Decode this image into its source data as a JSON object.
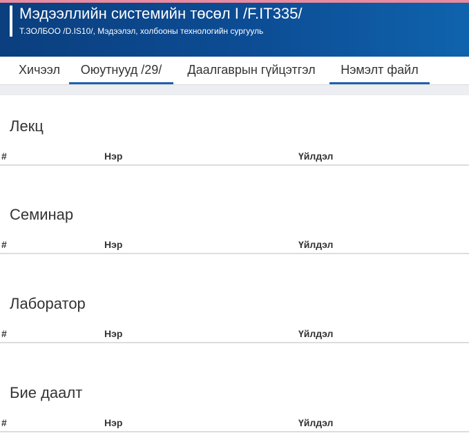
{
  "header": {
    "title": "Мэдээллийн системийн төсөл I /F.IT335/",
    "subtitle": "Т.ЗОЛБОО /D.IS10/, Мэдээлэл, холбооны технологийн сургууль"
  },
  "tabs": [
    {
      "label": "Хичээл",
      "active": false
    },
    {
      "label": "Оюутнууд /29/",
      "active": true
    },
    {
      "label": "Даалгаврын гүйцэтгэл",
      "active": false
    },
    {
      "label": "Нэмэлт файл",
      "active": true
    }
  ],
  "table_headers": {
    "num": "#",
    "name": "Нэр",
    "action": "Үйлдэл"
  },
  "sections": [
    {
      "title": "Лекц"
    },
    {
      "title": "Семинар"
    },
    {
      "title": "Лаборатор"
    },
    {
      "title": "Бие даалт"
    }
  ]
}
